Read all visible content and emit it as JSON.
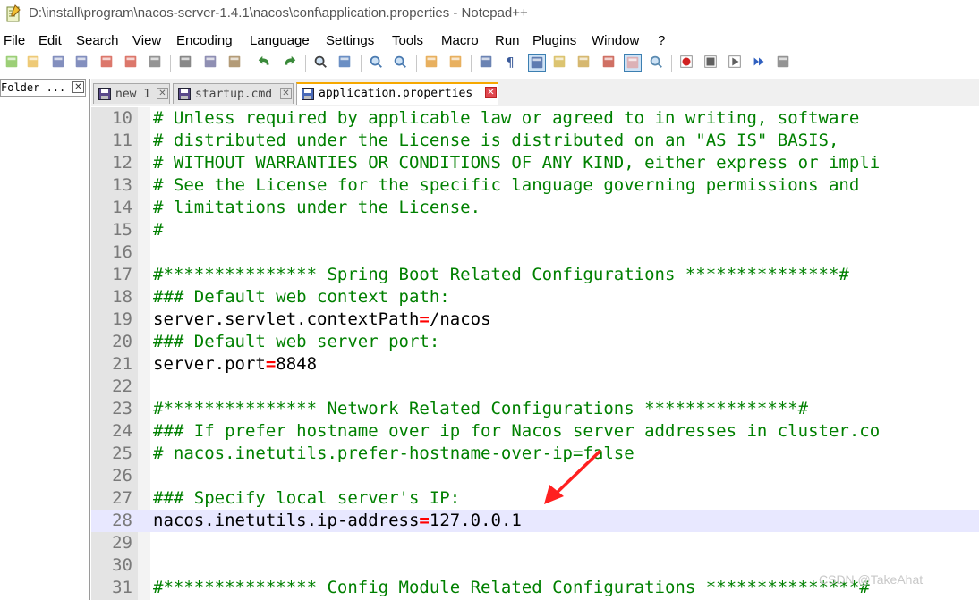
{
  "window": {
    "title": "D:\\install\\program\\nacos-server-1.4.1\\nacos\\conf\\application.properties - Notepad++"
  },
  "menu": [
    {
      "label": "File"
    },
    {
      "label": "Edit"
    },
    {
      "label": "Search"
    },
    {
      "label": "View"
    },
    {
      "label": "Encoding"
    },
    {
      "label": "Language"
    },
    {
      "label": "Settings"
    },
    {
      "label": "Tools"
    },
    {
      "label": "Macro"
    },
    {
      "label": "Run"
    },
    {
      "label": "Plugins"
    },
    {
      "label": "Window"
    },
    {
      "label": "?"
    }
  ],
  "toolbar": {
    "icons": [
      "new-file-icon",
      "open-file-icon",
      "save-icon",
      "save-all-icon",
      "close-icon",
      "close-all-icon",
      "print-icon",
      "cut-icon",
      "copy-icon",
      "paste-icon",
      "undo-icon",
      "redo-icon",
      "find-icon",
      "replace-icon",
      "zoom-in-icon",
      "zoom-out-icon",
      "sync-vertical-icon",
      "sync-horizontal-icon",
      "word-wrap-icon",
      "show-all-chars-icon",
      "indent-guide-icon",
      "document-map-icon",
      "function-list-icon",
      "folder-as-workspace-icon",
      "doc-list-icon",
      "monitoring-icon",
      "record-macro-icon",
      "stop-macro-icon",
      "play-macro-icon",
      "run-macro-multiple-icon",
      "save-macro-icon"
    ]
  },
  "folder_panel": {
    "label": "Folder ...",
    "close": "✕"
  },
  "tabs": [
    {
      "label": "new 1",
      "close": "✕",
      "active": false
    },
    {
      "label": "startup.cmd",
      "close": "✕",
      "active": false
    },
    {
      "label": "application.properties",
      "close": "✕",
      "active": true
    }
  ],
  "editor": {
    "current_line": 28,
    "lines": [
      {
        "n": "10",
        "type": "comment",
        "text": "# Unless required by applicable law or agreed to in writing, software"
      },
      {
        "n": "11",
        "type": "comment",
        "text": "# distributed under the License is distributed on an \"AS IS\" BASIS,"
      },
      {
        "n": "12",
        "type": "comment",
        "text": "# WITHOUT WARRANTIES OR CONDITIONS OF ANY KIND, either express or impli"
      },
      {
        "n": "13",
        "type": "comment",
        "text": "# See the License for the specific language governing permissions and"
      },
      {
        "n": "14",
        "type": "comment",
        "text": "# limitations under the License."
      },
      {
        "n": "15",
        "type": "comment",
        "text": "#"
      },
      {
        "n": "16",
        "type": "blank",
        "text": ""
      },
      {
        "n": "17",
        "type": "comment",
        "text": "#*************** Spring Boot Related Configurations ***************#"
      },
      {
        "n": "18",
        "type": "comment",
        "text": "### Default web context path:"
      },
      {
        "n": "19",
        "type": "kv",
        "key": "server.servlet.contextPath",
        "value": "/nacos"
      },
      {
        "n": "20",
        "type": "comment",
        "text": "### Default web server port:"
      },
      {
        "n": "21",
        "type": "kv",
        "key": "server.port",
        "value": "8848"
      },
      {
        "n": "22",
        "type": "blank",
        "text": ""
      },
      {
        "n": "23",
        "type": "comment",
        "text": "#*************** Network Related Configurations ***************#"
      },
      {
        "n": "24",
        "type": "comment",
        "text": "### If prefer hostname over ip for Nacos server addresses in cluster.co"
      },
      {
        "n": "25",
        "type": "comment",
        "text": "# nacos.inetutils.prefer-hostname-over-ip=false"
      },
      {
        "n": "26",
        "type": "blank",
        "text": ""
      },
      {
        "n": "27",
        "type": "comment",
        "text": "### Specify local server's IP:"
      },
      {
        "n": "28",
        "type": "kv",
        "key": "nacos.inetutils.ip-address",
        "value": "127.0.0.1"
      },
      {
        "n": "29",
        "type": "blank",
        "text": ""
      },
      {
        "n": "30",
        "type": "blank",
        "text": ""
      },
      {
        "n": "31",
        "type": "comment",
        "text": "#*************** Config Module Related Configurations ***************#"
      }
    ]
  },
  "watermark": "CSDN @TakeAhat",
  "colors": {
    "comment": "#008000",
    "operator": "#ff0000",
    "annotation_arrow": "#ff2020",
    "current_line": "#e8e8ff"
  }
}
